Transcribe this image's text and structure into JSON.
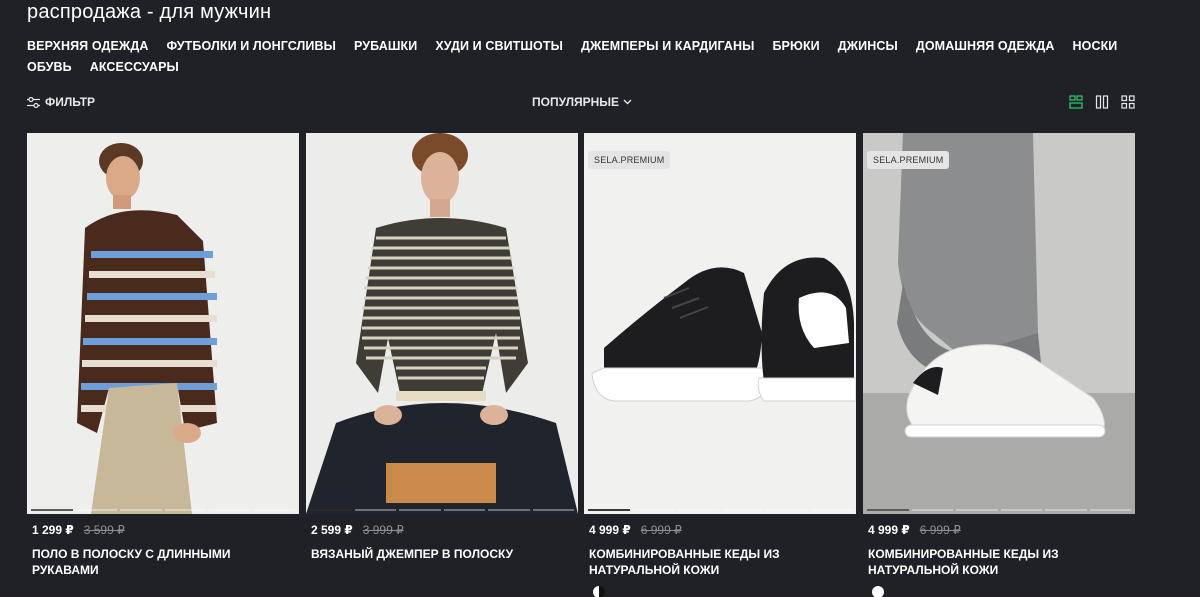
{
  "page": {
    "title": "распродажа - для мужчин"
  },
  "categories": {
    "row1": [
      "ВЕРХНЯЯ ОДЕЖДА",
      "ФУТБОЛКИ И ЛОНГСЛИВЫ",
      "РУБАШКИ",
      "ХУДИ И СВИТШОТЫ",
      "ДЖЕМПЕРЫ И КАРДИГАНЫ",
      "БРЮКИ",
      "ДЖИНСЫ",
      "ДОМАШНЯЯ ОДЕЖДА",
      "НОСКИ"
    ],
    "row2": [
      "ОБУВЬ",
      "АКСЕССУАРЫ"
    ]
  },
  "toolbar": {
    "filter_label": "ФИЛЬТР",
    "sort_label": "ПОПУЛЯРНЫЕ",
    "active_view_color": "#2ecc71"
  },
  "products": [
    {
      "price": "1 299 ₽",
      "old_price": "3 599 ₽",
      "name": "ПОЛО В ПОЛОСКУ С ДЛИННЫМИ РУКАВАМИ",
      "badge": ""
    },
    {
      "price": "2 599 ₽",
      "old_price": "3 999 ₽",
      "name": "ВЯЗАНЫЙ ДЖЕМПЕР В ПОЛОСКУ",
      "badge": ""
    },
    {
      "price": "4 999 ₽",
      "old_price": "6 999 ₽",
      "name": "КОМБИНИРОВАННЫЕ КЕДЫ ИЗ НАТУРАЛЬНОЙ КОЖИ",
      "badge": "SELA.PREMIUM"
    },
    {
      "price": "4 999 ₽",
      "old_price": "6 999 ₽",
      "name": "КОМБИНИРОВАННЫЕ КЕДЫ ИЗ НАТУРАЛЬНОЙ КОЖИ",
      "badge": "SELA.PREMIUM"
    }
  ]
}
